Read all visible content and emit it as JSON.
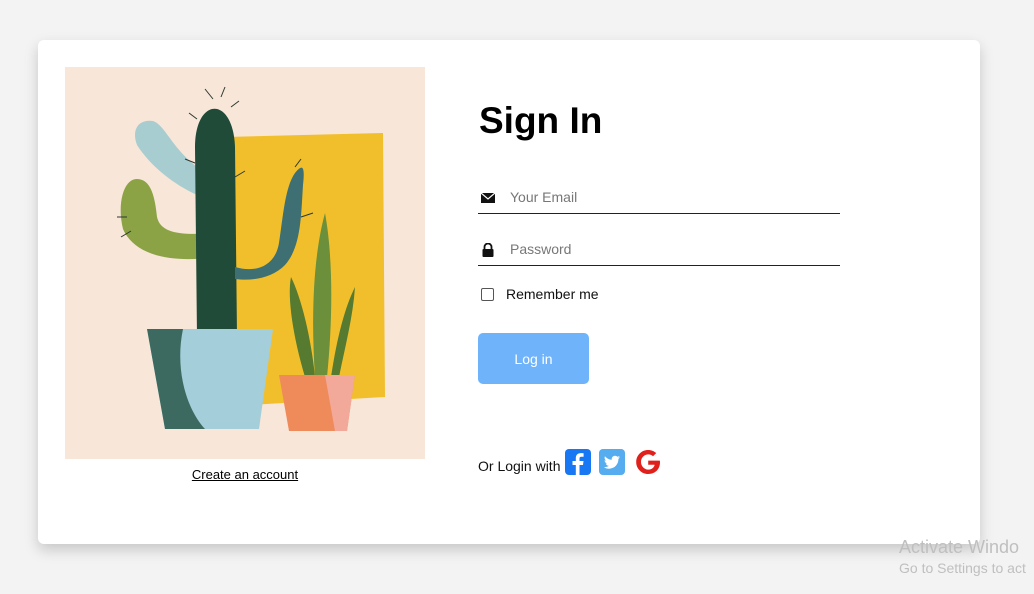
{
  "signin": {
    "title": "Sign In",
    "email_placeholder": "Your Email",
    "email_value": "",
    "password_placeholder": "Password",
    "password_value": "",
    "remember_label": "Remember me",
    "remember_checked": false,
    "login_label": "Log in",
    "social_text": "Or Login with",
    "social_icons": [
      "facebook-icon",
      "twitter-icon",
      "google-icon"
    ]
  },
  "left": {
    "create_account_label": "Create an account",
    "illustration": "cactus-illustration"
  },
  "colors": {
    "button": "#6fb3fb",
    "facebook": "#1877f2",
    "twitter": "#55acee",
    "google": "#e0201b",
    "illustration_bg": "#f8e6d9"
  },
  "watermark": {
    "line1": "Activate Windo",
    "line2": "Go to Settings to act"
  }
}
